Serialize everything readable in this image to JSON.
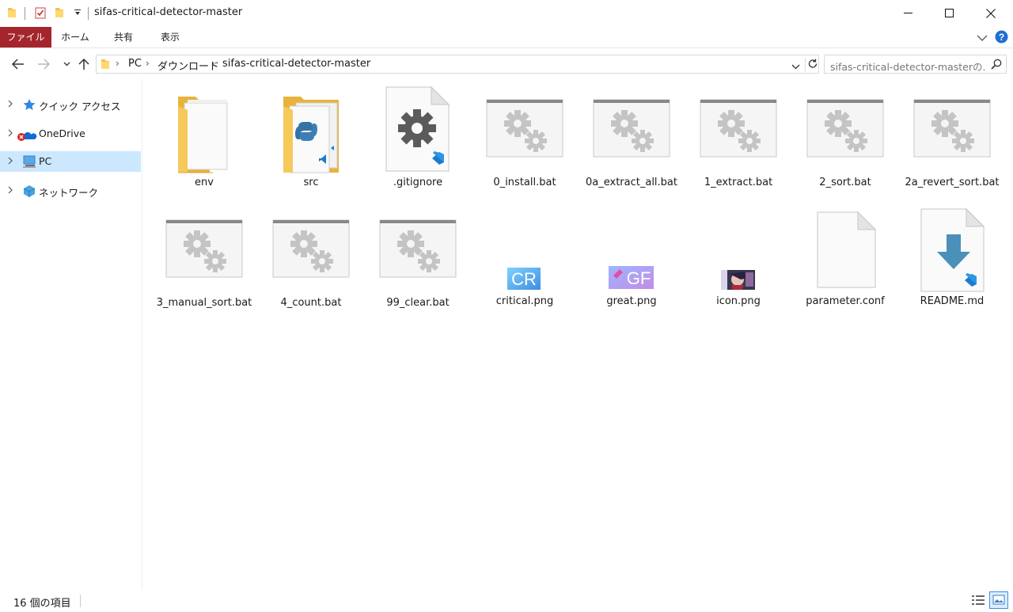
{
  "window": {
    "title": "sifas-critical-detector-master"
  },
  "ribbon": {
    "tabs": [
      "ファイル",
      "ホーム",
      "共有",
      "表示"
    ]
  },
  "address": {
    "crumbs": [
      "PC",
      "ダウンロード",
      "sifas-critical-detector-master"
    ],
    "search_placeholder": "sifas-critical-detector-masterの..."
  },
  "sidebar": {
    "items": [
      {
        "label": "クイック アクセス",
        "icon": "star-icon"
      },
      {
        "label": "OneDrive",
        "icon": "onedrive-error-icon"
      },
      {
        "label": "PC",
        "icon": "computer-icon"
      },
      {
        "label": "ネットワーク",
        "icon": "network-icon"
      }
    ]
  },
  "files": [
    {
      "name": "env",
      "type": "folder"
    },
    {
      "name": "src",
      "type": "python-folder"
    },
    {
      "name": ".gitignore",
      "type": "vscode-config"
    },
    {
      "name": "0_install.bat",
      "type": "bat"
    },
    {
      "name": "0a_extract_all.bat",
      "type": "bat"
    },
    {
      "name": "1_extract.bat",
      "type": "bat"
    },
    {
      "name": "2_sort.bat",
      "type": "bat"
    },
    {
      "name": "2a_revert_sort.bat",
      "type": "bat"
    },
    {
      "name": "3_manual_sort.bat",
      "type": "bat"
    },
    {
      "name": "4_count.bat",
      "type": "bat"
    },
    {
      "name": "99_clear.bat",
      "type": "bat"
    },
    {
      "name": "critical.png",
      "type": "png-critical"
    },
    {
      "name": "great.png",
      "type": "png-great"
    },
    {
      "name": "icon.png",
      "type": "png-icon"
    },
    {
      "name": "parameter.conf",
      "type": "blank-file"
    },
    {
      "name": "README.md",
      "type": "vscode-md"
    }
  ],
  "thumb_text": {
    "critical": "CR",
    "great": "GF"
  },
  "status": {
    "count": "16 個の項目"
  }
}
